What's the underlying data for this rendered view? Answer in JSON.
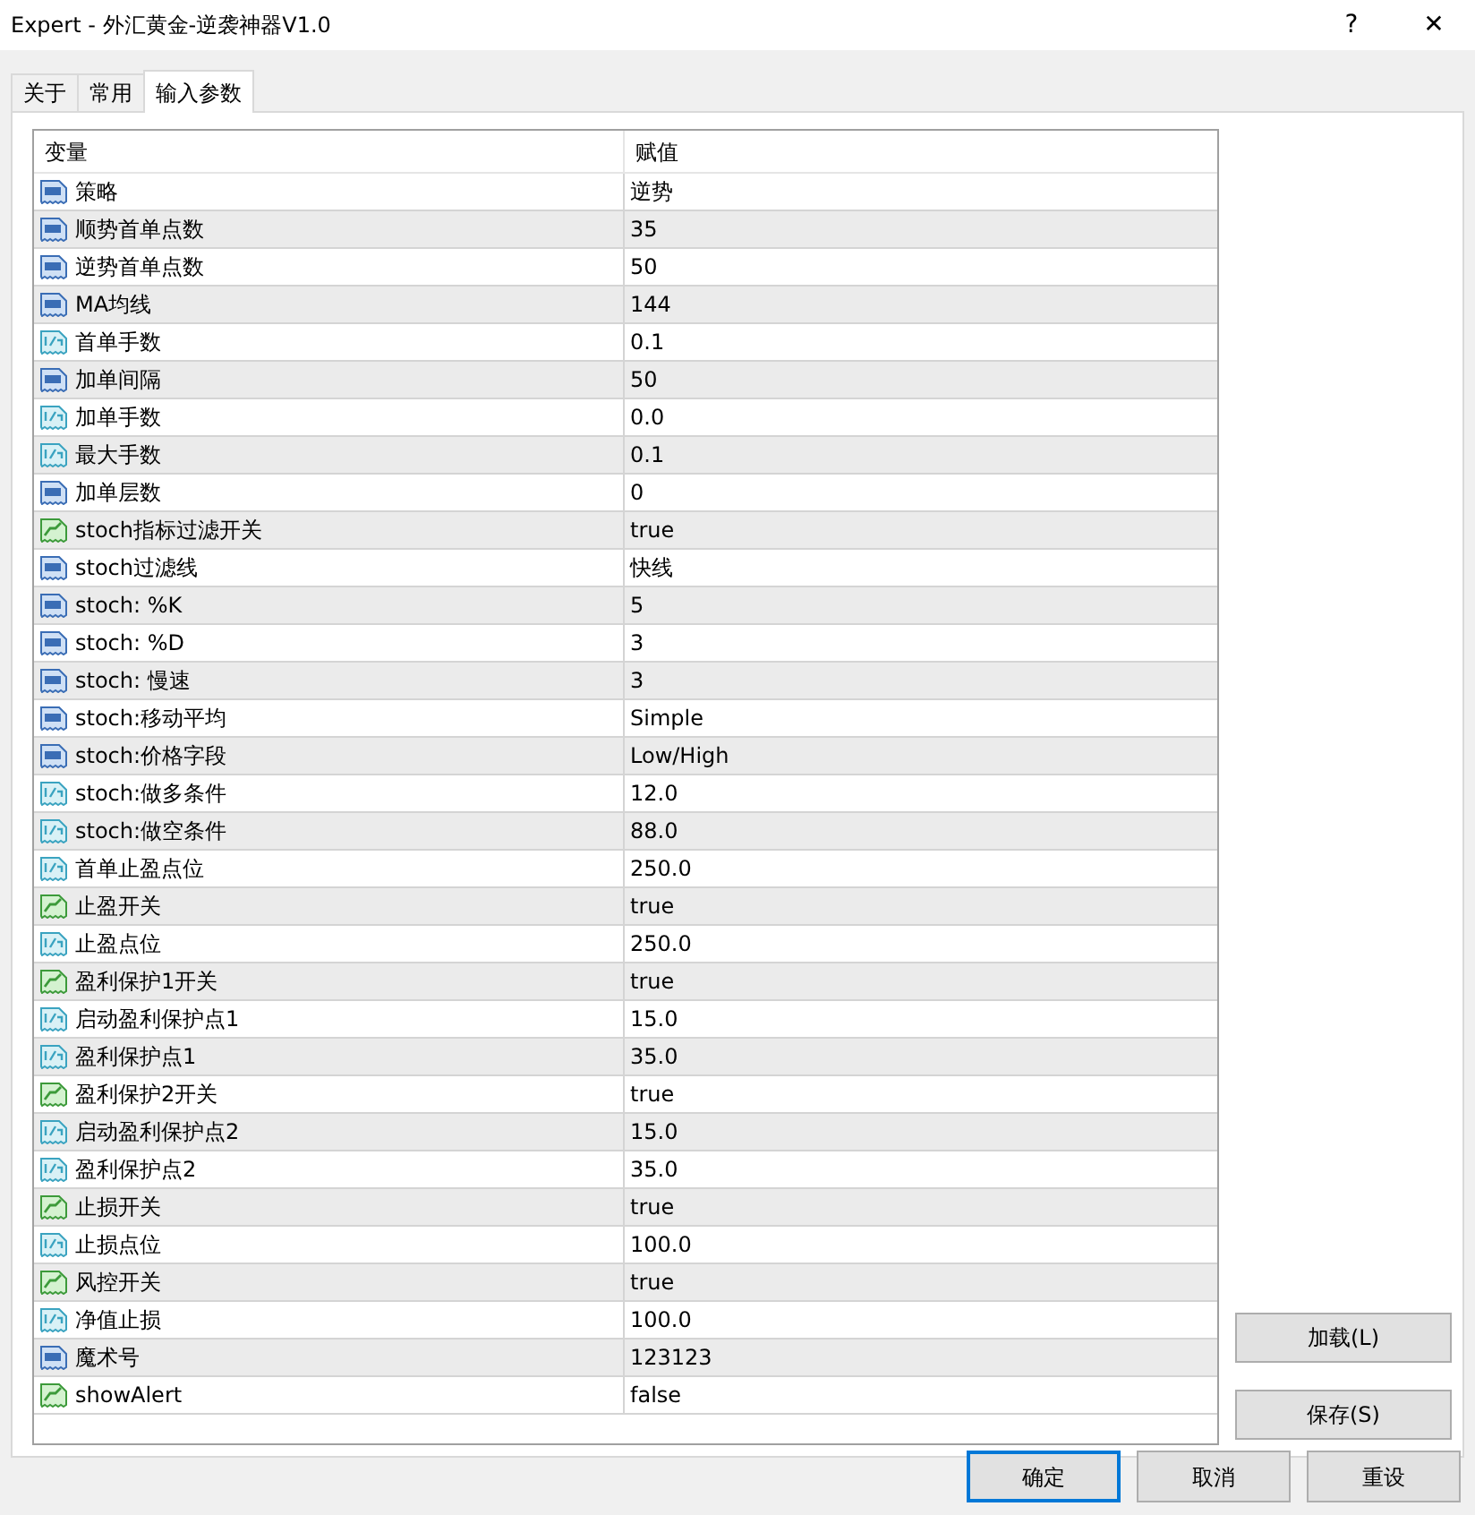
{
  "window": {
    "title": "Expert - 外汇黄金-逆袭神器V1.0",
    "help": "?",
    "close": "✕"
  },
  "tabs": [
    {
      "label": "关于",
      "selected": false
    },
    {
      "label": "常用",
      "selected": false
    },
    {
      "label": "输入参数",
      "selected": true
    }
  ],
  "table": {
    "columns": [
      "变量",
      "赋值"
    ],
    "rows": [
      {
        "kind": "int",
        "name": "策略",
        "value": "逆势"
      },
      {
        "kind": "int",
        "name": "顺势首单点数",
        "value": "35"
      },
      {
        "kind": "int",
        "name": "逆势首单点数",
        "value": "50"
      },
      {
        "kind": "int",
        "name": "MA均线",
        "value": "144"
      },
      {
        "kind": "double",
        "name": "首单手数",
        "value": "0.1"
      },
      {
        "kind": "int",
        "name": "加单间隔",
        "value": "50"
      },
      {
        "kind": "double",
        "name": "加单手数",
        "value": "0.0"
      },
      {
        "kind": "double",
        "name": "最大手数",
        "value": "0.1"
      },
      {
        "kind": "int",
        "name": "加单层数",
        "value": "0"
      },
      {
        "kind": "bool",
        "name": "stoch指标过滤开关",
        "value": "true"
      },
      {
        "kind": "int",
        "name": "stoch过滤线",
        "value": "快线"
      },
      {
        "kind": "int",
        "name": "stoch: %K",
        "value": "5"
      },
      {
        "kind": "int",
        "name": "stoch: %D",
        "value": "3"
      },
      {
        "kind": "int",
        "name": "stoch: 慢速",
        "value": "3"
      },
      {
        "kind": "int",
        "name": "stoch:移动平均",
        "value": "Simple"
      },
      {
        "kind": "int",
        "name": "stoch:价格字段",
        "value": "Low/High"
      },
      {
        "kind": "double",
        "name": "stoch:做多条件",
        "value": "12.0"
      },
      {
        "kind": "double",
        "name": "stoch:做空条件",
        "value": "88.0"
      },
      {
        "kind": "double",
        "name": "首单止盈点位",
        "value": "250.0"
      },
      {
        "kind": "bool",
        "name": "止盈开关",
        "value": "true"
      },
      {
        "kind": "double",
        "name": "止盈点位",
        "value": "250.0"
      },
      {
        "kind": "bool",
        "name": "盈利保护1开关",
        "value": "true"
      },
      {
        "kind": "double",
        "name": "启动盈利保护点1",
        "value": "15.0"
      },
      {
        "kind": "double",
        "name": "盈利保护点1",
        "value": "35.0"
      },
      {
        "kind": "bool",
        "name": "盈利保护2开关",
        "value": "true"
      },
      {
        "kind": "double",
        "name": "启动盈利保护点2",
        "value": "15.0"
      },
      {
        "kind": "double",
        "name": "盈利保护点2",
        "value": "35.0"
      },
      {
        "kind": "bool",
        "name": "止损开关",
        "value": "true"
      },
      {
        "kind": "double",
        "name": "止损点位",
        "value": "100.0"
      },
      {
        "kind": "bool",
        "name": "风控开关",
        "value": "true"
      },
      {
        "kind": "double",
        "name": "净值止损",
        "value": "100.0"
      },
      {
        "kind": "int",
        "name": "魔术号",
        "value": "123123"
      },
      {
        "kind": "bool",
        "name": "showAlert",
        "value": "false"
      }
    ]
  },
  "side_buttons": [
    "加载(L)",
    "保存(S)"
  ],
  "buttons": [
    {
      "label": "确定",
      "selected": true
    },
    {
      "label": "取消",
      "selected": false
    },
    {
      "label": "重设",
      "selected": false
    }
  ]
}
